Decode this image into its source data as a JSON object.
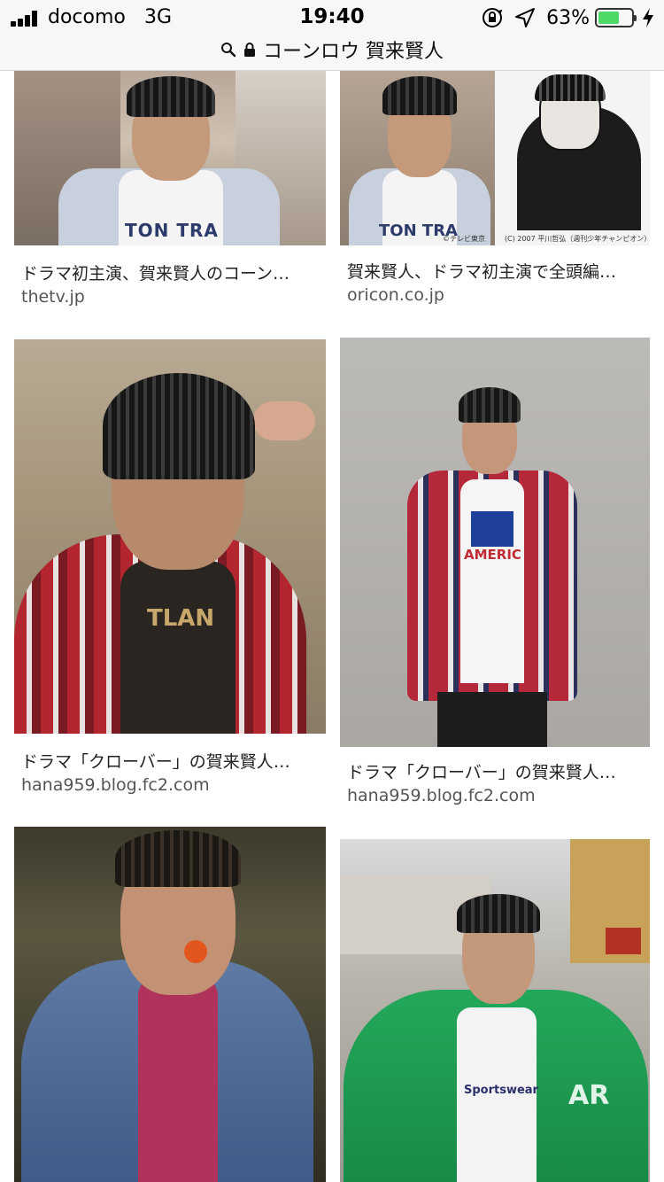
{
  "status_bar": {
    "carrier": "docomo",
    "network": "3G",
    "time": "19:40",
    "battery_percent": "63%",
    "battery_level": 0.63,
    "icons": [
      "orientation-lock-icon",
      "location-arrow-icon",
      "charging-bolt-icon"
    ]
  },
  "address_bar": {
    "query": "コーンロウ 賀来賢人",
    "icons": [
      "search-icon",
      "lock-icon"
    ]
  },
  "results": [
    {
      "caption": "ドラマ初主演、賀来賢人のコーン…",
      "source": "thetv.jp"
    },
    {
      "caption": "賀来賢人、ドラマ初主演で全頭編…",
      "source": "oricon.co.jp"
    },
    {
      "caption": "ドラマ「クローバー」の賀来賢人…",
      "source": "hana959.blog.fc2.com"
    },
    {
      "caption": "ドラマ「クローバー」の賀来賢人…",
      "source": "hana959.blog.fc2.com"
    },
    {
      "caption": "",
      "source": ""
    },
    {
      "caption": "",
      "source": ""
    }
  ],
  "image_text": {
    "r1_left_shirt": "TON TRA",
    "r1_right_shirt": "TON TRA",
    "r1_right_credit1": "©テレビ東京",
    "r1_right_credit2": "(C) 2007 平川哲弘（週刊少年チャンピオン）",
    "r2_left_shirt": "TLAN",
    "r2_right_shirt": "AMERIC",
    "r3_right_shirt": "Sportswear",
    "r3_right_jacket": "AR"
  },
  "colors": {
    "accent_battery": "#4cd964",
    "caption_text": "#222222",
    "domain_text": "#555555"
  }
}
